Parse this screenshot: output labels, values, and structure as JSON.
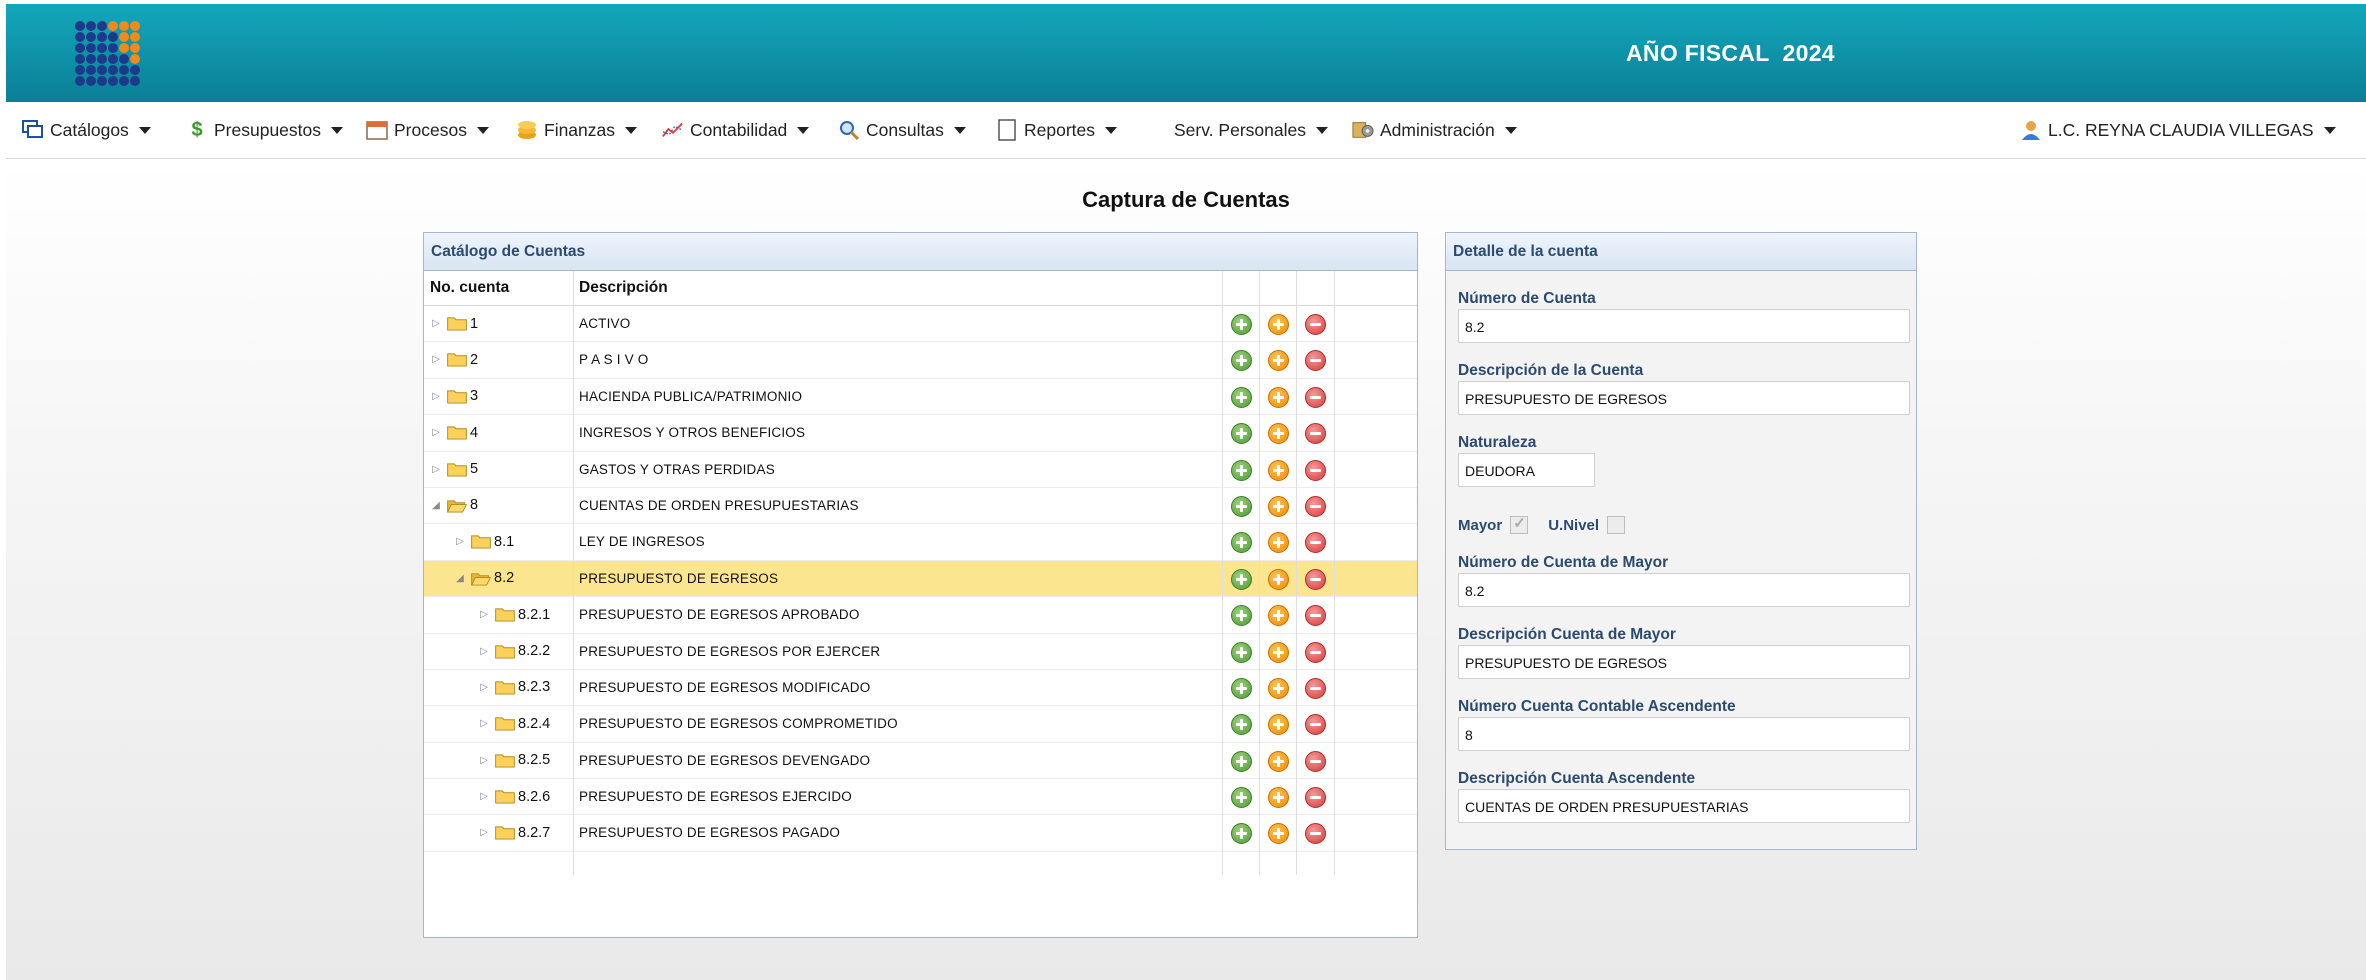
{
  "header": {
    "fiscal_year": "AÑO FISCAL  2024"
  },
  "menu": {
    "items": [
      {
        "label": "Catálogos",
        "icon": "catalogs-icon"
      },
      {
        "label": "Presupuestos",
        "icon": "money-icon"
      },
      {
        "label": "Procesos",
        "icon": "calendar-icon"
      },
      {
        "label": "Finanzas",
        "icon": "coins-icon"
      },
      {
        "label": "Contabilidad",
        "icon": "chart-line-icon"
      },
      {
        "label": "Consultas",
        "icon": "magnifier-icon"
      },
      {
        "label": "Reportes",
        "icon": "report-icon"
      },
      {
        "label": "Serv. Personales",
        "icon": ""
      },
      {
        "label": "Administración",
        "icon": "admin-icon"
      }
    ],
    "user": "L.C. REYNA CLAUDIA VILLEGAS"
  },
  "page": {
    "title": "Captura de Cuentas"
  },
  "catalog": {
    "title": "Catálogo de Cuentas",
    "col_no": "No. cuenta",
    "col_desc": "Descripción",
    "rows": [
      {
        "no": "1",
        "desc": "ACTIVO",
        "level": 0,
        "expanded": false,
        "selected": false
      },
      {
        "no": "2",
        "desc": "P A S I V O",
        "level": 0,
        "expanded": false,
        "selected": false
      },
      {
        "no": "3",
        "desc": "HACIENDA PUBLICA/PATRIMONIO",
        "level": 0,
        "expanded": false,
        "selected": false
      },
      {
        "no": "4",
        "desc": "INGRESOS Y OTROS BENEFICIOS",
        "level": 0,
        "expanded": false,
        "selected": false
      },
      {
        "no": "5",
        "desc": "GASTOS Y OTRAS PERDIDAS",
        "level": 0,
        "expanded": false,
        "selected": false
      },
      {
        "no": "8",
        "desc": "CUENTAS DE ORDEN PRESUPUESTARIAS",
        "level": 0,
        "expanded": true,
        "selected": false
      },
      {
        "no": "8.1",
        "desc": "LEY DE INGRESOS",
        "level": 1,
        "expanded": false,
        "selected": false
      },
      {
        "no": "8.2",
        "desc": "PRESUPUESTO DE EGRESOS",
        "level": 1,
        "expanded": true,
        "selected": true
      },
      {
        "no": "8.2.1",
        "desc": "PRESUPUESTO DE EGRESOS APROBADO",
        "level": 2,
        "expanded": false,
        "selected": false
      },
      {
        "no": "8.2.2",
        "desc": "PRESUPUESTO DE EGRESOS POR EJERCER",
        "level": 2,
        "expanded": false,
        "selected": false
      },
      {
        "no": "8.2.3",
        "desc": "PRESUPUESTO DE EGRESOS MODIFICADO",
        "level": 2,
        "expanded": false,
        "selected": false
      },
      {
        "no": "8.2.4",
        "desc": "PRESUPUESTO DE EGRESOS COMPROMETIDO",
        "level": 2,
        "expanded": false,
        "selected": false
      },
      {
        "no": "8.2.5",
        "desc": "PRESUPUESTO DE EGRESOS DEVENGADO",
        "level": 2,
        "expanded": false,
        "selected": false
      },
      {
        "no": "8.2.6",
        "desc": "PRESUPUESTO DE EGRESOS EJERCIDO",
        "level": 2,
        "expanded": false,
        "selected": false
      },
      {
        "no": "8.2.7",
        "desc": "PRESUPUESTO DE EGRESOS PAGADO",
        "level": 2,
        "expanded": false,
        "selected": false
      }
    ]
  },
  "detail": {
    "title": "Detalle de la cuenta",
    "numero_label": "Número de Cuenta",
    "numero_value": "8.2",
    "descripcion_label": "Descripción de la Cuenta",
    "descripcion_value": "PRESUPUESTO DE EGRESOS",
    "naturaleza_label": "Naturaleza",
    "naturaleza_value": "DEUDORA",
    "mayor_label": "Mayor",
    "mayor_checked": true,
    "univel_label": "U.Nivel",
    "univel_checked": false,
    "num_mayor_label": "Número de Cuenta de Mayor",
    "num_mayor_value": "8.2",
    "desc_mayor_label": "Descripción Cuenta de Mayor",
    "desc_mayor_value": "PRESUPUESTO DE EGRESOS",
    "num_ascendente_label": "Número Cuenta Contable Ascendente",
    "num_ascendente_value": "8",
    "desc_ascendente_label": "Descripción Cuenta Ascendente",
    "desc_ascendente_value": "CUENTAS DE ORDEN PRESUPUESTARIAS"
  },
  "colors": {
    "header": "#0f97ac",
    "selected_row": "#fbe58e",
    "label_blue": "#2b4a6f"
  }
}
